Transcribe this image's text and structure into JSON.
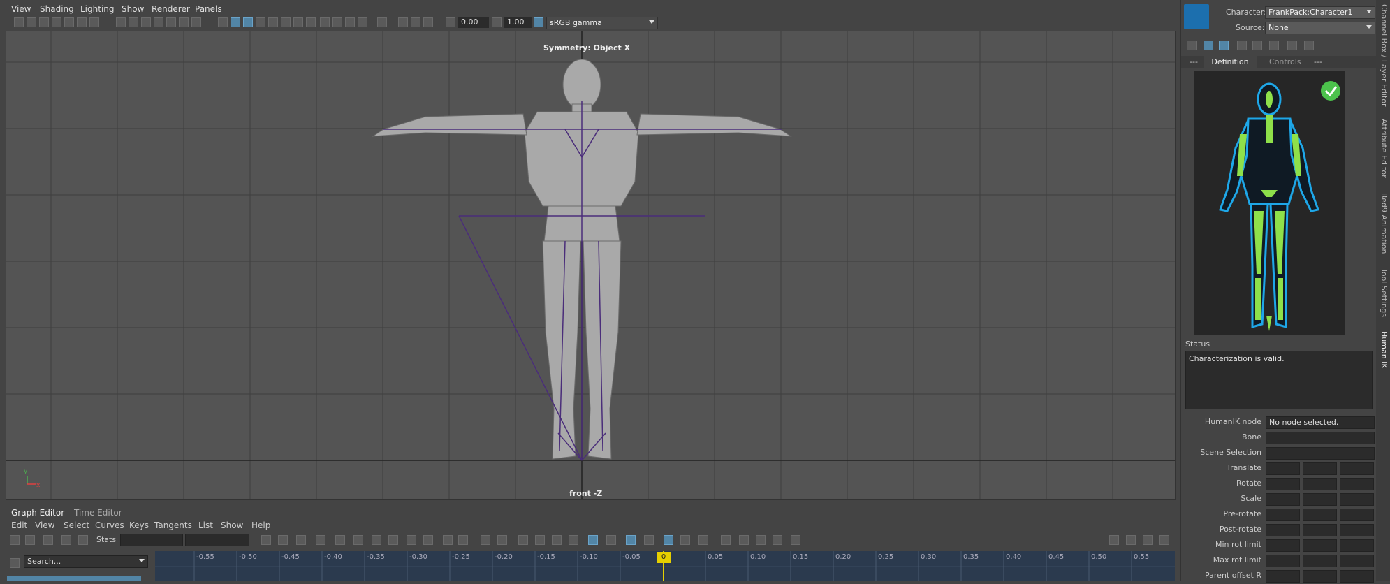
{
  "menubar": {
    "items": [
      "View",
      "Shading",
      "Lighting",
      "Show",
      "Renderer",
      "Panels"
    ]
  },
  "toolbar": {
    "exposure": "0.00",
    "gamma": "1.00",
    "colorspace": "sRGB gamma"
  },
  "viewport": {
    "symmetry_label": "Symmetry: Object X",
    "camera_label": "front -Z",
    "axis_y": "y",
    "axis_x": "x"
  },
  "graph_editor": {
    "tabs": [
      "Graph Editor",
      "Time Editor"
    ],
    "menu": [
      "Edit",
      "View",
      "Select",
      "Curves",
      "Keys",
      "Tangents",
      "List",
      "Show",
      "Help"
    ],
    "stats_label": "Stats",
    "search_placeholder": "Search...",
    "ruler": [
      "-0.55",
      "-0.50",
      "-0.45",
      "-0.40",
      "-0.35",
      "-0.30",
      "-0.25",
      "-0.20",
      "-0.15",
      "-0.10",
      "-0.05",
      "0",
      "0.05",
      "0.10",
      "0.15",
      "0.20",
      "0.25",
      "0.30",
      "0.35",
      "0.40",
      "0.45",
      "0.50",
      "0.55"
    ],
    "current_frame": "0"
  },
  "hik": {
    "character_label": "Character:",
    "character_value": "FrankPack:Character1",
    "source_label": "Source:",
    "source_value": "None",
    "tabs": [
      "---",
      "Definition",
      "Controls",
      "---"
    ],
    "status_label": "Status",
    "status_text": "Characterization is valid.",
    "props": [
      {
        "label": "HumanIK node",
        "value": "No node selected.",
        "cols": 1
      },
      {
        "label": "Bone",
        "value": "",
        "cols": 1
      },
      {
        "label": "Scene Selection",
        "value": "",
        "cols": 1
      },
      {
        "label": "Translate",
        "value": "",
        "cols": 3
      },
      {
        "label": "Rotate",
        "value": "",
        "cols": 3
      },
      {
        "label": "Scale",
        "value": "",
        "cols": 3
      },
      {
        "label": "Pre-rotate",
        "value": "",
        "cols": 3
      },
      {
        "label": "Post-rotate",
        "value": "",
        "cols": 3
      },
      {
        "label": "Min rot limit",
        "value": "",
        "cols": 3
      },
      {
        "label": "Max rot limit",
        "value": "",
        "cols": 3
      },
      {
        "label": "Parent offset R",
        "value": "",
        "cols": 3
      }
    ]
  },
  "sidebar_tabs": [
    "Channel Box / Layer Editor",
    "Attribute Editor",
    "Red9 Animation",
    "Tool Settings",
    "Human IK"
  ],
  "colors": {
    "bone_green": "#8ee04a",
    "outline_blue": "#1ea7e8",
    "check_green": "#4cc24c",
    "active_blue": "#5285a6"
  }
}
